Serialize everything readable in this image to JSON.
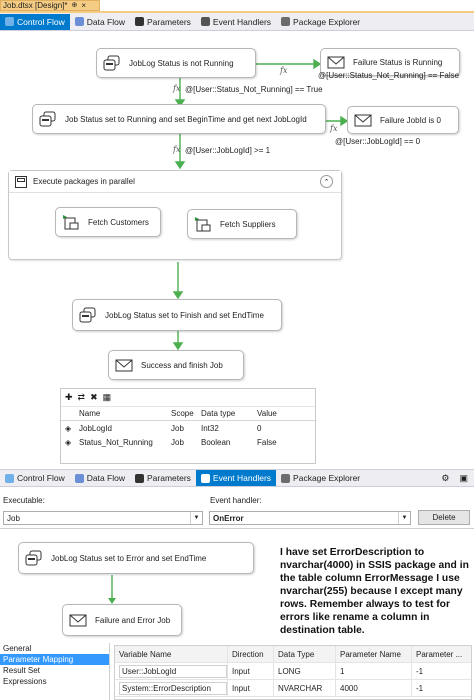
{
  "document_tab": {
    "title": "Job.dtsx [Design]*",
    "pin": "⊕",
    "close": "×"
  },
  "designer_tabs": [
    "Control Flow",
    "Data Flow",
    "Parameters",
    "Event Handlers",
    "Package Explorer"
  ],
  "control_flow": {
    "tasks": {
      "jobLogNotRunning": "JobLog Status is not Running",
      "failureStatusRunning": "Failure Status is Running",
      "setRunning": "Job Status set to Running and set BeginTime and get next JobLogId",
      "failureJobId": "Failure JobId is 0",
      "setFinish": "JobLog Status set to Finish and set EndTime",
      "success": "Success and finish Job"
    },
    "constraints": {
      "c1": "@[User::Status_Not_Running] == False",
      "c2": "@[User::Status_Not_Running] == True",
      "c3": "@[User::JobLogId] == 0",
      "c4": "@[User::JobLogId] >= 1",
      "fx": "fx"
    },
    "container": {
      "title": "Execute packages in parallel",
      "tasks": [
        "Fetch Customers",
        "Fetch Suppliers"
      ]
    }
  },
  "variables": {
    "columns": [
      "Name",
      "Scope",
      "Data type",
      "Value"
    ],
    "rows": [
      {
        "name": "JobLogId",
        "scope": "Job",
        "type": "Int32",
        "value": "0"
      },
      {
        "name": "Status_Not_Running",
        "scope": "Job",
        "type": "Boolean",
        "value": "False"
      }
    ]
  },
  "event_handler_tabs": [
    "Control Flow",
    "Data Flow",
    "Parameters",
    "Event Handlers",
    "Package Explorer"
  ],
  "event_handler_form": {
    "executable_label": "Executable:",
    "executable_value": "Job",
    "handler_label": "Event handler:",
    "handler_value": "OnError",
    "delete_label": "Delete"
  },
  "event_handler_canvas": {
    "tasks": {
      "setError": "JobLog Status set to Error and set EndTime",
      "failureError": "Failure and Error Job"
    }
  },
  "note": "I have set ErrorDescription to nvarchar(4000) in SSIS package and in the table column ErrorMessage I use nvarchar(255) because I except many rows. Remember always to test for errors like rename a column in destination table.",
  "editor_pages": [
    "General",
    "Parameter Mapping",
    "Result Set",
    "Expressions"
  ],
  "param_mapping": {
    "columns": [
      "Variable Name",
      "Direction",
      "Data Type",
      "Parameter Name",
      "Parameter ..."
    ],
    "rows": [
      {
        "variable": "User::JobLogId",
        "direction": "Input",
        "type": "LONG",
        "param": "1",
        "size": "-1"
      },
      {
        "variable": "System::ErrorDescription",
        "direction": "Input",
        "type": "NVARCHAR",
        "param": "4000",
        "size": "-1"
      }
    ]
  },
  "colors": {
    "accent": "#007acc",
    "constraint": "#4caf50",
    "tab_active": "#f5cc84"
  }
}
